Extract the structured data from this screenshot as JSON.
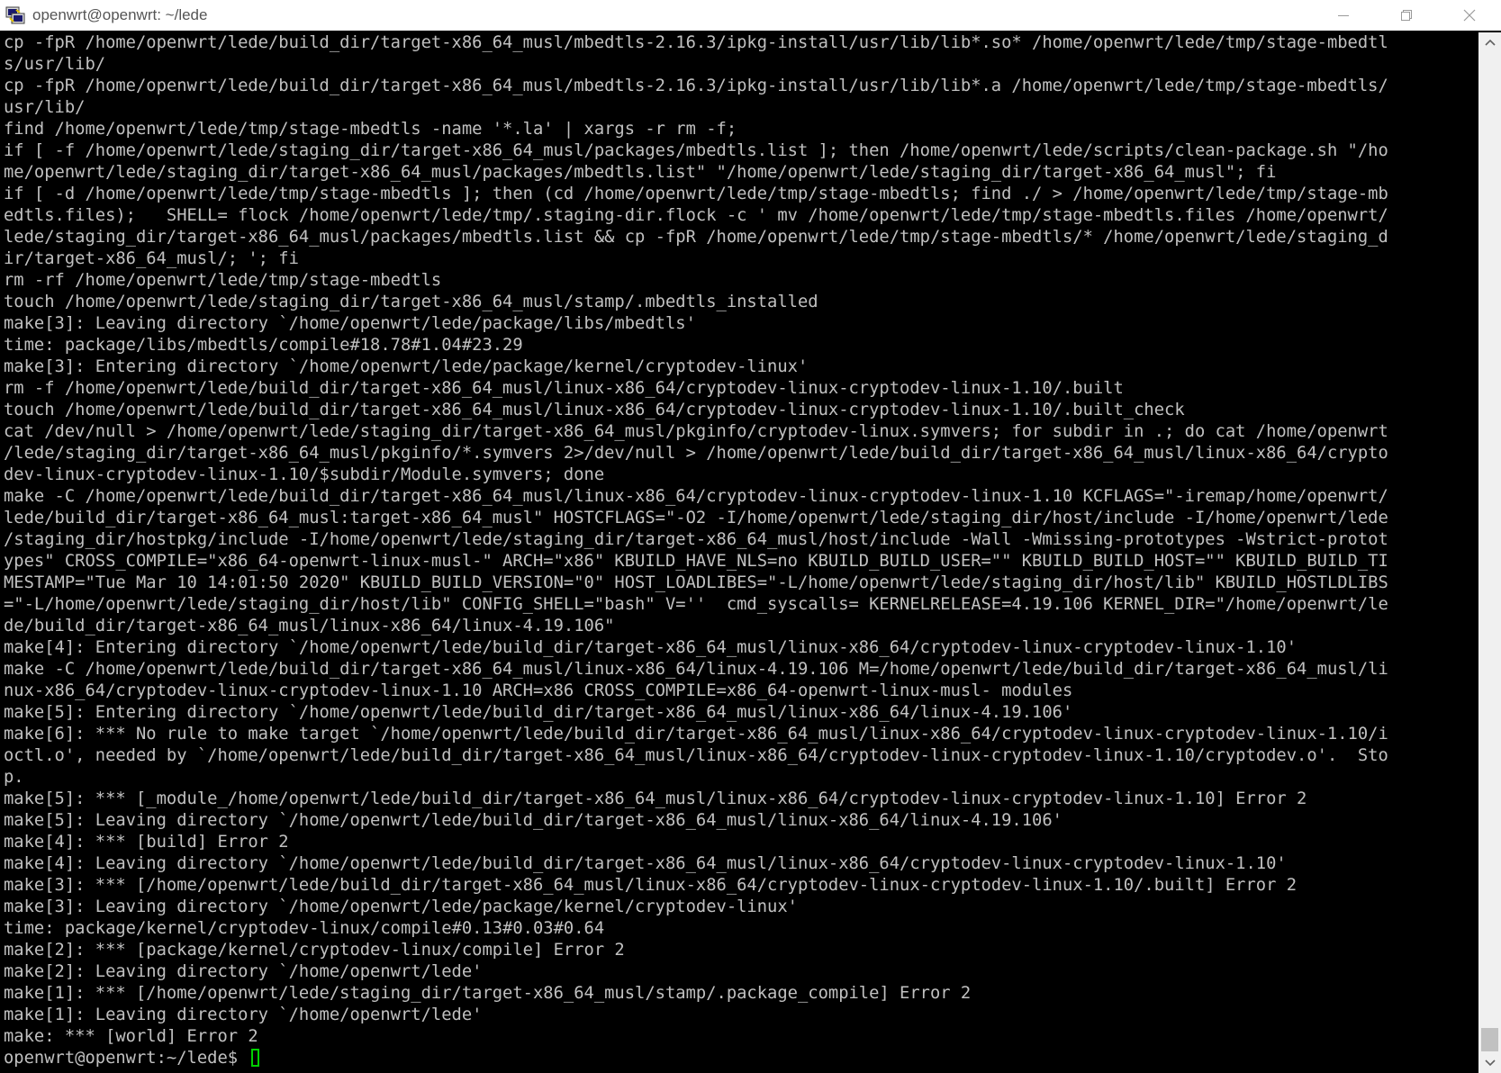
{
  "window": {
    "title": "openwrt@openwrt: ~/lede"
  },
  "terminal": {
    "lines": [
      "cp -fpR /home/openwrt/lede/build_dir/target-x86_64_musl/mbedtls-2.16.3/ipkg-install/usr/lib/lib*.so* /home/openwrt/lede/tmp/stage-mbedtl",
      "s/usr/lib/",
      "cp -fpR /home/openwrt/lede/build_dir/target-x86_64_musl/mbedtls-2.16.3/ipkg-install/usr/lib/lib*.a /home/openwrt/lede/tmp/stage-mbedtls/",
      "usr/lib/",
      "find /home/openwrt/lede/tmp/stage-mbedtls -name '*.la' | xargs -r rm -f;",
      "if [ -f /home/openwrt/lede/staging_dir/target-x86_64_musl/packages/mbedtls.list ]; then /home/openwrt/lede/scripts/clean-package.sh \"/ho",
      "me/openwrt/lede/staging_dir/target-x86_64_musl/packages/mbedtls.list\" \"/home/openwrt/lede/staging_dir/target-x86_64_musl\"; fi",
      "if [ -d /home/openwrt/lede/tmp/stage-mbedtls ]; then (cd /home/openwrt/lede/tmp/stage-mbedtls; find ./ > /home/openwrt/lede/tmp/stage-mb",
      "edtls.files);   SHELL= flock /home/openwrt/lede/tmp/.staging-dir.flock -c ' mv /home/openwrt/lede/tmp/stage-mbedtls.files /home/openwrt/",
      "lede/staging_dir/target-x86_64_musl/packages/mbedtls.list && cp -fpR /home/openwrt/lede/tmp/stage-mbedtls/* /home/openwrt/lede/staging_d",
      "ir/target-x86_64_musl/; '; fi",
      "rm -rf /home/openwrt/lede/tmp/stage-mbedtls",
      "touch /home/openwrt/lede/staging_dir/target-x86_64_musl/stamp/.mbedtls_installed",
      "make[3]: Leaving directory `/home/openwrt/lede/package/libs/mbedtls'",
      "time: package/libs/mbedtls/compile#18.78#1.04#23.29",
      "make[3]: Entering directory `/home/openwrt/lede/package/kernel/cryptodev-linux'",
      "rm -f /home/openwrt/lede/build_dir/target-x86_64_musl/linux-x86_64/cryptodev-linux-cryptodev-linux-1.10/.built",
      "touch /home/openwrt/lede/build_dir/target-x86_64_musl/linux-x86_64/cryptodev-linux-cryptodev-linux-1.10/.built_check",
      "cat /dev/null > /home/openwrt/lede/staging_dir/target-x86_64_musl/pkginfo/cryptodev-linux.symvers; for subdir in .; do cat /home/openwrt",
      "/lede/staging_dir/target-x86_64_musl/pkginfo/*.symvers 2>/dev/null > /home/openwrt/lede/build_dir/target-x86_64_musl/linux-x86_64/crypto",
      "dev-linux-cryptodev-linux-1.10/$subdir/Module.symvers; done",
      "make -C /home/openwrt/lede/build_dir/target-x86_64_musl/linux-x86_64/cryptodev-linux-cryptodev-linux-1.10 KCFLAGS=\"-iremap/home/openwrt/",
      "lede/build_dir/target-x86_64_musl:target-x86_64_musl\" HOSTCFLAGS=\"-O2 -I/home/openwrt/lede/staging_dir/host/include -I/home/openwrt/lede",
      "/staging_dir/hostpkg/include -I/home/openwrt/lede/staging_dir/target-x86_64_musl/host/include -Wall -Wmissing-prototypes -Wstrict-protot",
      "ypes\" CROSS_COMPILE=\"x86_64-openwrt-linux-musl-\" ARCH=\"x86\" KBUILD_HAVE_NLS=no KBUILD_BUILD_USER=\"\" KBUILD_BUILD_HOST=\"\" KBUILD_BUILD_TI",
      "MESTAMP=\"Tue Mar 10 14:01:50 2020\" KBUILD_BUILD_VERSION=\"0\" HOST_LOADLIBES=\"-L/home/openwrt/lede/staging_dir/host/lib\" KBUILD_HOSTLDLIBS",
      "=\"-L/home/openwrt/lede/staging_dir/host/lib\" CONFIG_SHELL=\"bash\" V=''  cmd_syscalls= KERNELRELEASE=4.19.106 KERNEL_DIR=\"/home/openwrt/le",
      "de/build_dir/target-x86_64_musl/linux-x86_64/linux-4.19.106\"",
      "make[4]: Entering directory `/home/openwrt/lede/build_dir/target-x86_64_musl/linux-x86_64/cryptodev-linux-cryptodev-linux-1.10'",
      "make -C /home/openwrt/lede/build_dir/target-x86_64_musl/linux-x86_64/linux-4.19.106 M=/home/openwrt/lede/build_dir/target-x86_64_musl/li",
      "nux-x86_64/cryptodev-linux-cryptodev-linux-1.10 ARCH=x86 CROSS_COMPILE=x86_64-openwrt-linux-musl- modules",
      "make[5]: Entering directory `/home/openwrt/lede/build_dir/target-x86_64_musl/linux-x86_64/linux-4.19.106'",
      "make[6]: *** No rule to make target `/home/openwrt/lede/build_dir/target-x86_64_musl/linux-x86_64/cryptodev-linux-cryptodev-linux-1.10/i",
      "octl.o', needed by `/home/openwrt/lede/build_dir/target-x86_64_musl/linux-x86_64/cryptodev-linux-cryptodev-linux-1.10/cryptodev.o'.  Sto",
      "p.",
      "make[5]: *** [_module_/home/openwrt/lede/build_dir/target-x86_64_musl/linux-x86_64/cryptodev-linux-cryptodev-linux-1.10] Error 2",
      "make[5]: Leaving directory `/home/openwrt/lede/build_dir/target-x86_64_musl/linux-x86_64/linux-4.19.106'",
      "make[4]: *** [build] Error 2",
      "make[4]: Leaving directory `/home/openwrt/lede/build_dir/target-x86_64_musl/linux-x86_64/cryptodev-linux-cryptodev-linux-1.10'",
      "make[3]: *** [/home/openwrt/lede/build_dir/target-x86_64_musl/linux-x86_64/cryptodev-linux-cryptodev-linux-1.10/.built] Error 2",
      "make[3]: Leaving directory `/home/openwrt/lede/package/kernel/cryptodev-linux'",
      "time: package/kernel/cryptodev-linux/compile#0.13#0.03#0.64",
      "make[2]: *** [package/kernel/cryptodev-linux/compile] Error 2",
      "make[2]: Leaving directory `/home/openwrt/lede'",
      "make[1]: *** [/home/openwrt/lede/staging_dir/target-x86_64_musl/stamp/.package_compile] Error 2",
      "make[1]: Leaving directory `/home/openwrt/lede'",
      "make: *** [world] Error 2"
    ],
    "prompt": "openwrt@openwrt:~/lede$ ",
    "text_color": "#c0c0c0",
    "cursor_color": "#00d000"
  },
  "icons": {
    "app": "putty-icon",
    "minimize": "minimize-icon",
    "maximize": "restore-icon",
    "close": "close-icon",
    "scroll_up": "chevron-up-icon",
    "scroll_down": "chevron-down-icon"
  }
}
